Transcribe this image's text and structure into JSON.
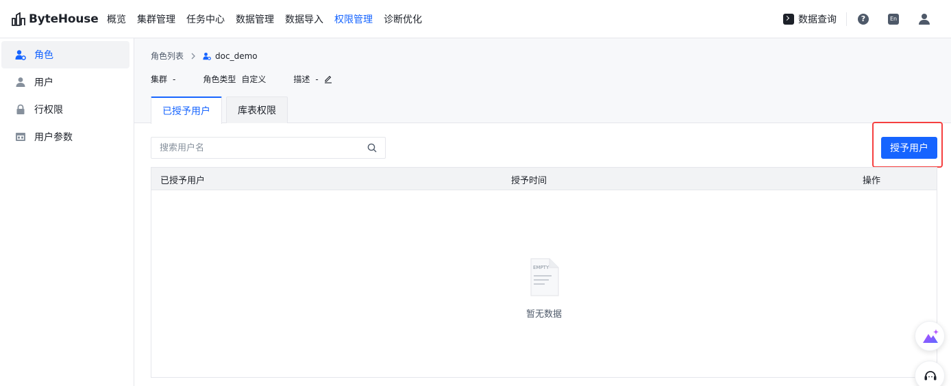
{
  "app": {
    "logo_text": "ByteHouse"
  },
  "nav": {
    "items": [
      {
        "label": "概览"
      },
      {
        "label": "集群管理"
      },
      {
        "label": "任务中心"
      },
      {
        "label": "数据管理"
      },
      {
        "label": "数据导入"
      },
      {
        "label": "权限管理",
        "active": true
      },
      {
        "label": "诊断优化"
      }
    ],
    "query_label": "数据查询",
    "help_glyph": "?",
    "lang_glyph": "En"
  },
  "sidebar": {
    "items": [
      {
        "label": "角色",
        "icon": "role-icon",
        "active": true
      },
      {
        "label": "用户",
        "icon": "user-icon"
      },
      {
        "label": "行权限",
        "icon": "lock-icon"
      },
      {
        "label": "用户参数",
        "icon": "params-icon"
      }
    ]
  },
  "breadcrumb": {
    "parent": "角色列表",
    "current": "doc_demo"
  },
  "meta": {
    "cluster_label": "集群",
    "cluster_value": "-",
    "role_type_label": "角色类型",
    "role_type_value": "自定义",
    "desc_label": "描述",
    "desc_value": "-"
  },
  "tabs": [
    {
      "label": "已授予用户",
      "active": true
    },
    {
      "label": "库表权限"
    }
  ],
  "search": {
    "placeholder": "搜索用户名",
    "value": ""
  },
  "grant_button": {
    "label": "授予用户"
  },
  "table": {
    "columns": [
      "已授予用户",
      "授予时间",
      "操作"
    ],
    "rows": [],
    "empty_text": "暂无数据",
    "empty_icon_text": "EMPTY"
  },
  "colors": {
    "accent": "#1664ff",
    "highlight": "#f53f3f"
  }
}
